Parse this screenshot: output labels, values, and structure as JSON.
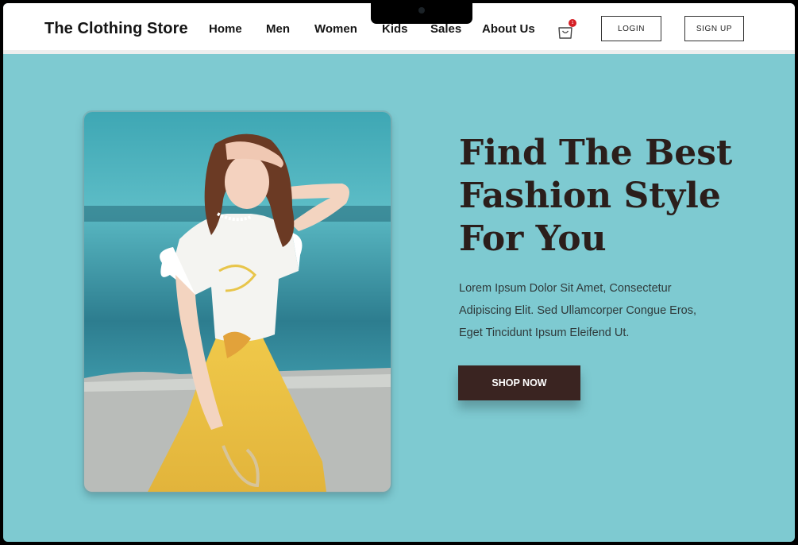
{
  "header": {
    "brand": "The Clothing Store",
    "nav": [
      "Home",
      "Men",
      "Women",
      "Kids",
      "Sales",
      "About Us"
    ],
    "cart_count": "1",
    "login_label": "LOGIN",
    "signup_label": "SIGN UP"
  },
  "hero": {
    "title_lines": [
      "Find The Best",
      "Fashion Style",
      "For You"
    ],
    "description_lines": [
      "Lorem Ipsum Dolor Sit Amet, Consectetur",
      "Adipiscing Elit. Sed Ullamcorper Congue Eros,",
      "Eget Tincidunt Ipsum Eleifend Ut."
    ],
    "cta_label": "SHOP NOW"
  },
  "icons": {
    "cart": "shopping-bag-icon"
  },
  "colors": {
    "hero_background": "#7ecad1",
    "cta_background": "#3a2421",
    "title_color": "#2b1e1b",
    "badge": "#d52026"
  }
}
